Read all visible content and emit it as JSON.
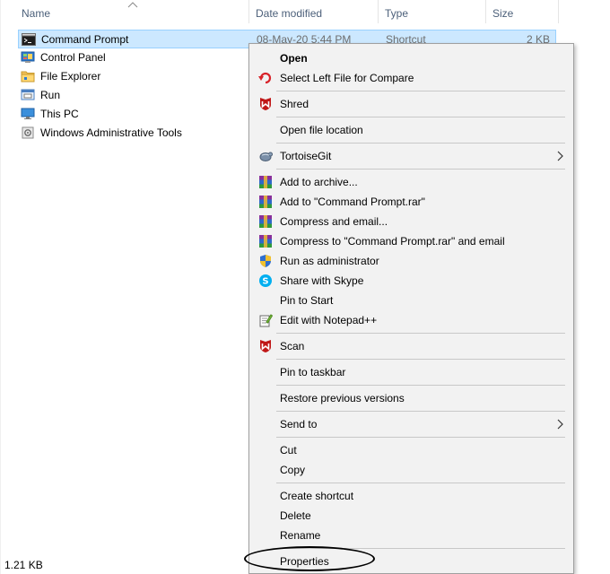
{
  "columns": {
    "name": "Name",
    "date_modified": "Date modified",
    "type": "Type",
    "size": "Size"
  },
  "files": [
    {
      "name": "Command Prompt",
      "date": "08-May-20 5:44 PM",
      "type": "Shortcut",
      "size": "2 KB",
      "icon": "cmd-icon",
      "selected": true
    },
    {
      "name": "Control Panel",
      "date": "",
      "type": "",
      "size": "",
      "icon": "control-panel-icon"
    },
    {
      "name": "File Explorer",
      "date": "",
      "type": "",
      "size": "",
      "icon": "folder-icon"
    },
    {
      "name": "Run",
      "date": "",
      "type": "",
      "size": "",
      "icon": "run-icon"
    },
    {
      "name": "This PC",
      "date": "",
      "type": "",
      "size": "",
      "icon": "pc-icon"
    },
    {
      "name": "Windows Administrative Tools",
      "date": "",
      "type": "",
      "size": "",
      "icon": "admin-tools-icon"
    }
  ],
  "status": {
    "selection_size": "1.21 KB"
  },
  "menu": {
    "open": "Open",
    "select_left_compare": "Select Left File for Compare",
    "shred": "Shred",
    "open_file_location": "Open file location",
    "tortoisegit": "TortoiseGit",
    "add_to_archive": "Add to archive...",
    "add_to_rar": "Add to \"Command Prompt.rar\"",
    "compress_email": "Compress and email...",
    "compress_rar_email": "Compress to \"Command Prompt.rar\" and email",
    "run_as_admin": "Run as administrator",
    "share_skype": "Share with Skype",
    "pin_start": "Pin to Start",
    "edit_notepad": "Edit with Notepad++",
    "scan": "Scan",
    "pin_taskbar": "Pin to taskbar",
    "restore_versions": "Restore previous versions",
    "send_to": "Send to",
    "cut": "Cut",
    "copy": "Copy",
    "create_shortcut": "Create shortcut",
    "delete": "Delete",
    "rename": "Rename",
    "properties": "Properties"
  },
  "colors": {
    "selection_bg": "#cce8ff",
    "menu_bg": "#f2f2f2",
    "header_text": "#4c607a",
    "mcafee_red": "#c01818",
    "winrar_purple": "#7a2f8c",
    "skype_blue": "#00aff0"
  }
}
